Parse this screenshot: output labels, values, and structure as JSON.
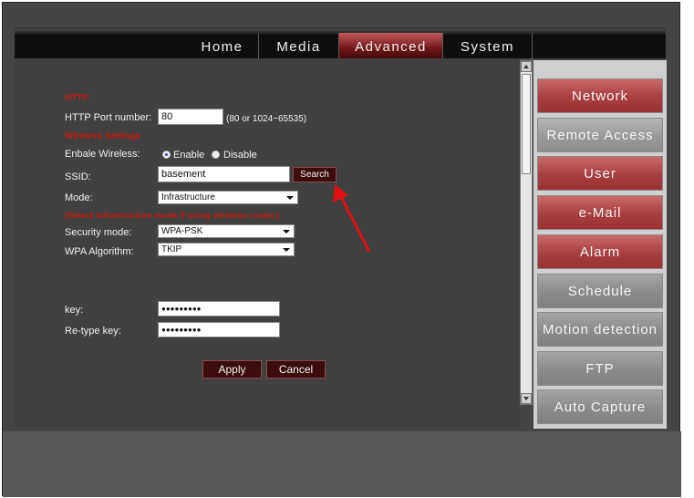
{
  "nav": {
    "items": [
      {
        "label": "Home"
      },
      {
        "label": "Media"
      },
      {
        "label": "Advanced"
      },
      {
        "label": "System"
      }
    ],
    "active_index": 2
  },
  "form": {
    "http_section": "HTTP",
    "http_port_label": "HTTP Port number:",
    "http_port_value": "80",
    "http_port_hint": "(80 or 1024~65535)",
    "wireless_section": "Wireless Settings",
    "enable_wireless_label": "Enbale Wireless:",
    "enable_option": "Enable",
    "disable_option": "Disable",
    "ssid_label": "SSID:",
    "ssid_value": "basement",
    "search_label": "Search",
    "mode_label": "Mode:",
    "mode_value": "Infrastructure",
    "mode_note": "(Select infrastructure mode if using wireless router.)",
    "security_label": "Security mode:",
    "security_value": "WPA-PSK",
    "algorithm_label": "WPA Algorithm:",
    "algorithm_value": "TKIP",
    "key_label": "key:",
    "key_value": "●●●●●●●●●",
    "retype_label": "Re-type  key:",
    "retype_value": "●●●●●●●●●",
    "apply_label": "Apply",
    "cancel_label": "Cancel"
  },
  "sidebar": {
    "items": [
      {
        "label": "Network",
        "style": "red"
      },
      {
        "label": "Remote Access",
        "style": "selected"
      },
      {
        "label": "User",
        "style": "red"
      },
      {
        "label": "e-Mail",
        "style": "red"
      },
      {
        "label": "Alarm",
        "style": "red"
      },
      {
        "label": "Schedule",
        "style": "gray"
      },
      {
        "label": "Motion detection",
        "style": "gray"
      },
      {
        "label": "FTP",
        "style": "gray"
      },
      {
        "label": "Auto Capture",
        "style": "gray"
      }
    ]
  },
  "colors": {
    "accent_red": "#c81818",
    "arrow_red": "#e01010",
    "button_dark_red": "#3c0d0d"
  }
}
